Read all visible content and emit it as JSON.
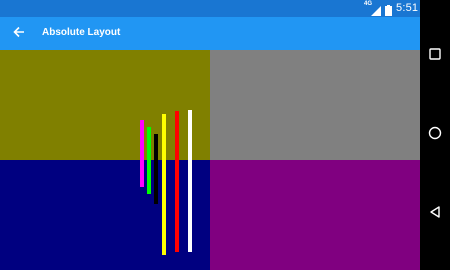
{
  "status_bar": {
    "network": "4G",
    "time": "5:51",
    "icons": [
      "signal-icon",
      "battery-icon"
    ]
  },
  "app_bar": {
    "title": "Absolute Layout",
    "back_icon": "back-arrow-icon"
  },
  "layout": {
    "quadrant_colors": {
      "top_left": "#808000",
      "top_right": "#808080",
      "bottom_left": "#000080",
      "bottom_right": "#800080"
    },
    "lines": [
      {
        "name": "magenta-line",
        "color": "#FF00FF"
      },
      {
        "name": "green-line",
        "color": "#00FF00"
      },
      {
        "name": "black-line",
        "color": "#000000"
      },
      {
        "name": "yellow-line",
        "color": "#FFFF00"
      },
      {
        "name": "red-line",
        "color": "#FF0000"
      },
      {
        "name": "white-line",
        "color": "#FFFFFF"
      }
    ]
  },
  "nav_bar": {
    "icons": [
      "recents-icon",
      "home-icon",
      "back-icon"
    ]
  }
}
